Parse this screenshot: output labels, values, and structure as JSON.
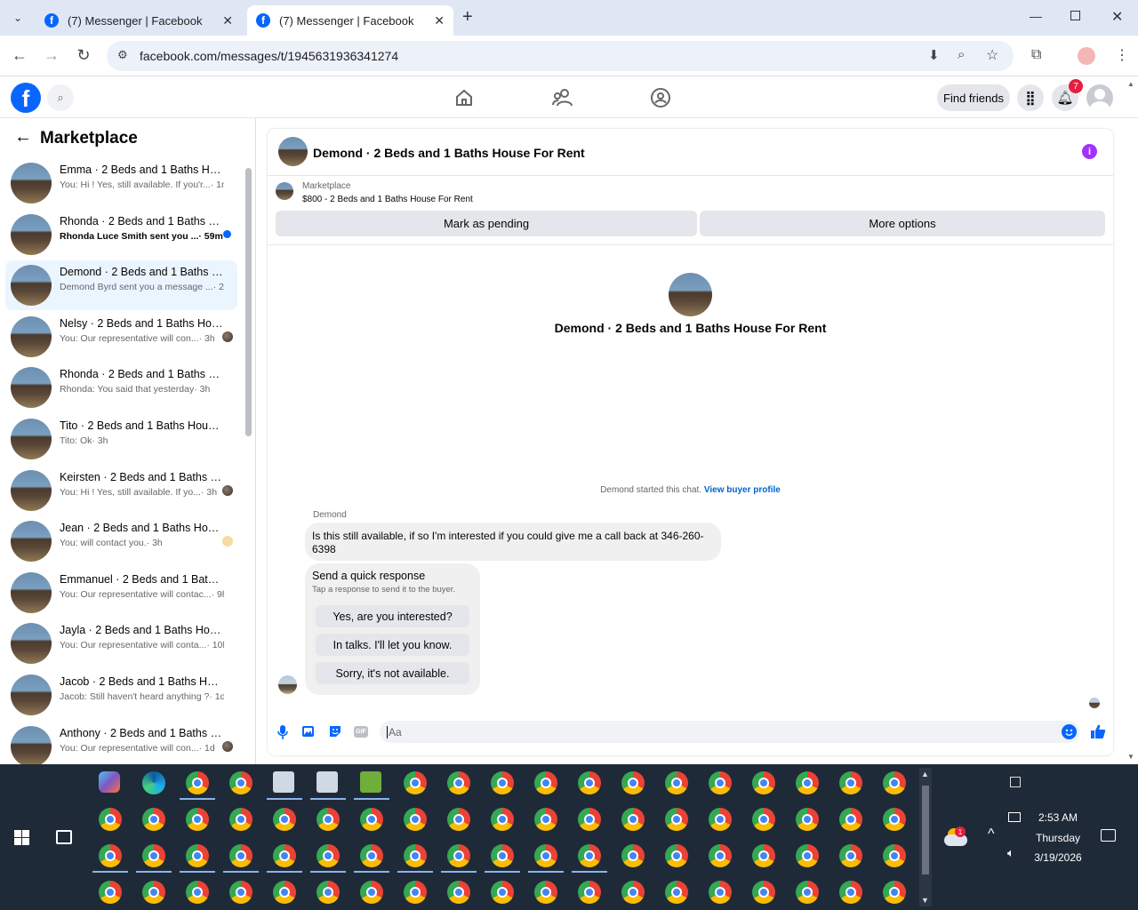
{
  "browser": {
    "tabs": [
      {
        "label": "(7) Messenger | Facebook"
      },
      {
        "label": "(7) Messenger | Facebook"
      }
    ],
    "url": "facebook.com/messages/t/1945631936341274"
  },
  "header": {
    "find_friends": "Find friends",
    "notification_count": "7"
  },
  "sidebar": {
    "title": "Marketplace",
    "conversations": [
      {
        "title": "Emma · 2 Beds and 1 Baths House For Rent",
        "snippet": "You: Hi ! Yes, still available. If you'r...",
        "time": "· 1m"
      },
      {
        "title": "Rhonda · 2 Beds and 1 Baths House For Rent",
        "snippet": "Rhonda Luce Smith sent you ...",
        "time": "· 59m"
      },
      {
        "title": "Demond · 2 Beds and 1 Baths House For Rent",
        "snippet": "Demond Byrd sent you a message ...",
        "time": "· 2h"
      },
      {
        "title": "Nelsy · 2 Beds and 1 Baths House For Rent",
        "snippet": "You: Our representative will con...",
        "time": "· 3h"
      },
      {
        "title": "Rhonda · 2 Beds and 1 Baths House For Rent",
        "snippet": "Rhonda: You said that yesterday",
        "time": "· 3h"
      },
      {
        "title": "Tito · 2 Beds and 1 Baths House For Rent",
        "snippet": "Tito: Ok",
        "time": "· 3h"
      },
      {
        "title": "Keirsten · 2 Beds and 1 Baths House For Rent",
        "snippet": "You: Hi ! Yes, still available. If yo...",
        "time": "· 3h"
      },
      {
        "title": "Jean · 2 Beds and 1 Baths House For Rent",
        "snippet": "You: will contact you.",
        "time": "· 3h"
      },
      {
        "title": "Emmanuel · 2 Beds and 1 Baths House For Rent",
        "snippet": "You: Our representative will contac...",
        "time": "· 9h"
      },
      {
        "title": "Jayla · 2 Beds and 1 Baths House For Rent",
        "snippet": "You: Our representative will conta...",
        "time": "· 10h"
      },
      {
        "title": "Jacob · 2 Beds and 1 Baths House For Rent",
        "snippet": "Jacob: Still haven't heard anything ?",
        "time": "· 1d"
      },
      {
        "title": "Anthony · 2 Beds and 1 Baths House For Rent",
        "snippet": "You: Our representative will con...",
        "time": "· 1d"
      }
    ]
  },
  "chat": {
    "title": "Demond · 2 Beds and 1 Baths House For Rent",
    "listing_source": "Marketplace",
    "listing_text": "$800 - 2 Beds and 1 Baths House For Rent",
    "mark_pending": "Mark as pending",
    "more_options": "More options",
    "profile_name": "Demond · 2 Beds and 1 Baths House For Rent",
    "started_text": "Demond started this chat.",
    "view_profile": "View buyer profile",
    "sender_name": "Demond",
    "message": "Is this still available, if so I'm interested if you could give me a call back at 346-260-6398",
    "quick_title": "Send a quick response",
    "quick_sub": "Tap a response to send it to the buyer.",
    "quick_responses": [
      "Yes, are you interested?",
      "In talks. I'll let you know.",
      "Sorry, it's not available."
    ],
    "composer_placeholder": "Aa"
  },
  "taskbar": {
    "time": "2:53 AM",
    "day": "Thursday",
    "date": "3/19/2026",
    "weather_badge": "1"
  }
}
